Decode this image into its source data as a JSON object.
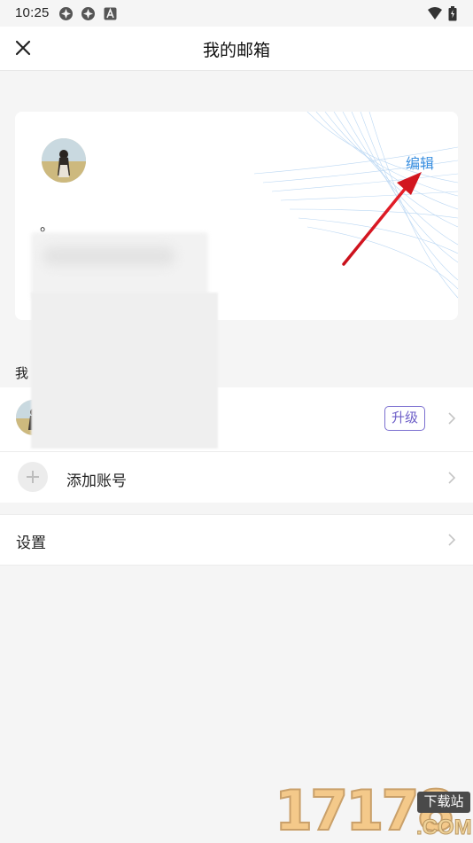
{
  "status_bar": {
    "time": "10:25",
    "left_icons": [
      "circle-badge-icon",
      "circle-badge-icon",
      "a-box-icon"
    ],
    "right_icons": [
      "wifi-icon",
      "battery-icon"
    ]
  },
  "header": {
    "title": "我的邮箱",
    "close_icon": "close-icon"
  },
  "profile_card": {
    "edit_label": "编辑",
    "note_text": "。",
    "accent_color": "#3a8fe0"
  },
  "accounts_section": {
    "label": "我"
  },
  "account_row": {
    "badge_label": "升级",
    "badge_color": "#6d5fc8"
  },
  "add_account": {
    "label": "添加账号"
  },
  "settings_row": {
    "label": "设置"
  },
  "watermark": {
    "number": "17178",
    "tag": "下载站",
    "domain": ".COM"
  }
}
